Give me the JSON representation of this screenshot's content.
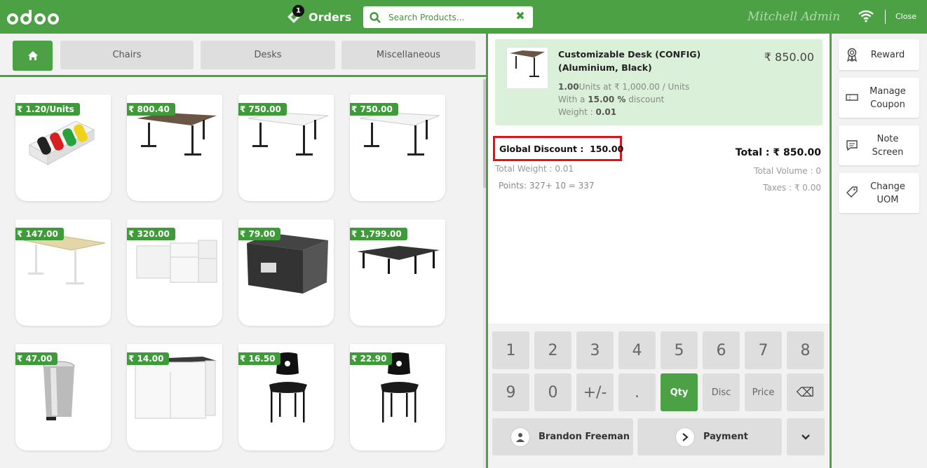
{
  "header": {
    "logo_text": "odoo",
    "orders_label": "Orders",
    "orders_count": "1",
    "search_placeholder": "Search Products...",
    "user_name": "Mitchell Admin",
    "close_label": "Close"
  },
  "categories": [
    "Chairs",
    "Desks",
    "Miscellaneous"
  ],
  "products": [
    {
      "price": "₹ 1.20/Units",
      "icon": "markers-image"
    },
    {
      "price": "₹ 800.40",
      "icon": "dark-desk-image"
    },
    {
      "price": "₹ 750.00",
      "icon": "white-desk-image"
    },
    {
      "price": "₹ 750.00",
      "icon": "white-desk-image"
    },
    {
      "price": "₹ 147.00",
      "icon": "wood-desk-image"
    },
    {
      "price": "₹ 320.00",
      "icon": "cabinet-image"
    },
    {
      "price": "₹ 79.00",
      "icon": "storage-box-image"
    },
    {
      "price": "₹ 1,799.00",
      "icon": "large-desk-image"
    },
    {
      "price": "₹ 47.00",
      "icon": "pedal-bin-image"
    },
    {
      "price": "₹ 14.00",
      "icon": "drawer-cabinet-image"
    },
    {
      "price": "₹ 16.50",
      "icon": "chair-image"
    },
    {
      "price": "₹ 22.90",
      "icon": "chair-image"
    }
  ],
  "orderline": {
    "name": "Customizable Desk (CONFIG) (Aluminium, Black)",
    "amount": "₹ 850.00",
    "qty": "1.00",
    "unit_text": "Units at ₹ 1,000.00 / Units",
    "discount_prefix": "With a",
    "discount_value": "15.00 %",
    "discount_suffix": "discount",
    "weight_label": "Weight :",
    "weight_value": "0.01"
  },
  "summary": {
    "global_discount_label": "Global Discount :",
    "global_discount_value": "150.00",
    "total": "Total : ₹ 850.00",
    "total_weight": "Total Weight : 0.01",
    "points": "Points: 327+ 10 = 337",
    "total_volume": "Total Volume : 0",
    "taxes": "Taxes : ₹ 0.00"
  },
  "numpad": {
    "row1": [
      "1",
      "2",
      "3",
      "4",
      "5",
      "6",
      "7",
      "8"
    ],
    "row2": [
      "9",
      "0",
      "+/-",
      ".",
      "Qty",
      "Disc",
      "Price",
      "⌫"
    ],
    "active_mode": "Qty",
    "customer": "Brandon Freeman",
    "payment": "Payment"
  },
  "actions": [
    {
      "label": "Reward",
      "icon": "reward-icon"
    },
    {
      "label": "Manage Coupon",
      "icon": "coupon-icon"
    },
    {
      "label": "Note Screen",
      "icon": "note-icon"
    },
    {
      "label": "Change UOM",
      "icon": "tag-icon"
    }
  ],
  "colors": {
    "brand": "#4ba144",
    "highlight": "#e0131b",
    "line_bg": "#dbf0d8"
  }
}
